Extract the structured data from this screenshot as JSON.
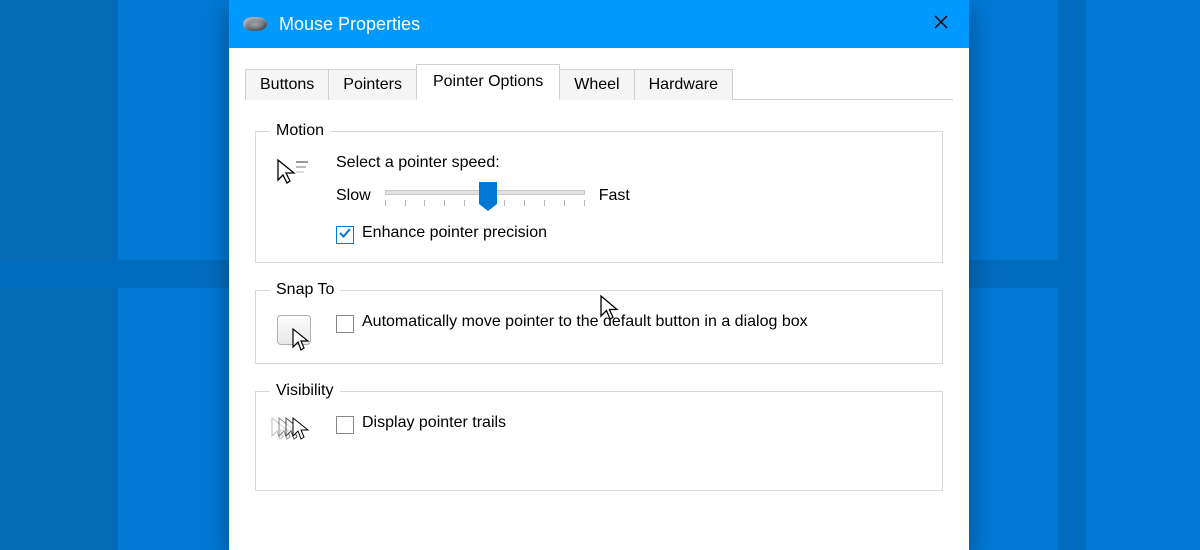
{
  "window": {
    "title": "Mouse Properties"
  },
  "tabs": [
    {
      "label": "Buttons",
      "active": false
    },
    {
      "label": "Pointers",
      "active": false
    },
    {
      "label": "Pointer Options",
      "active": true
    },
    {
      "label": "Wheel",
      "active": false
    },
    {
      "label": "Hardware",
      "active": false
    }
  ],
  "motion": {
    "legend": "Motion",
    "select_speed_label": "Select a pointer speed:",
    "slow_label": "Slow",
    "fast_label": "Fast",
    "slider": {
      "min": 1,
      "max": 11,
      "value": 6
    },
    "enhance_precision": {
      "label": "Enhance pointer precision",
      "checked": true
    }
  },
  "snap_to": {
    "legend": "Snap To",
    "auto_move": {
      "label": "Automatically move pointer to the default button in a dialog box",
      "checked": false
    }
  },
  "visibility": {
    "legend": "Visibility",
    "pointer_trails": {
      "label": "Display pointer trails",
      "checked": false
    }
  },
  "colors": {
    "accent": "#0078d4",
    "titlebar": "#0099ff"
  }
}
